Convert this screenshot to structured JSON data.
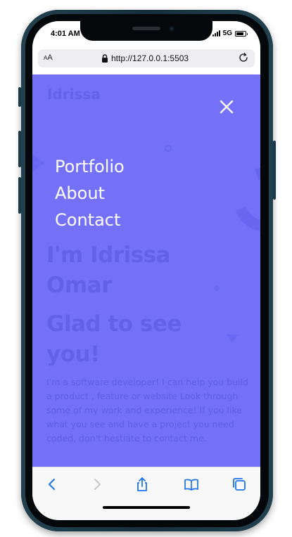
{
  "device": {
    "status_bar": {
      "time": "4:01 AM",
      "network": "5G",
      "battery_level": 0.85
    },
    "signal_bars": 4
  },
  "browser": {
    "text_size_label_small": "A",
    "text_size_label_large": "A",
    "url": "http://127.0.0.1:5503"
  },
  "page": {
    "brand": "Idrissa",
    "heading": "I'm Idrissa Omar",
    "subheading": "Glad to see you!",
    "bio": "I'm a software developer! I can help you build a product , feature or website Look through some of my work and experience! If you like what you see and have a project you need coded, don't hestiate to contact me."
  },
  "menu": {
    "items": [
      {
        "label": "Portfolio"
      },
      {
        "label": "About"
      },
      {
        "label": "Contact"
      }
    ]
  },
  "colors": {
    "overlay": "#7471f8",
    "text_under_overlay": "#6360ea",
    "menu_text": "#ffffff",
    "toolbar_icon_active": "#1a73e8",
    "toolbar_icon_disabled": "#c6c6cc"
  }
}
